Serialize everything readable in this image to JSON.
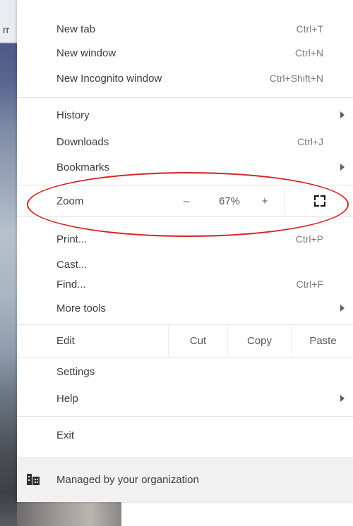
{
  "background": {
    "left_text": "rr"
  },
  "menu": {
    "items_group1": [
      {
        "label": "New tab",
        "shortcut": "Ctrl+T"
      },
      {
        "label": "New window",
        "shortcut": "Ctrl+N"
      },
      {
        "label": "New Incognito window",
        "shortcut": "Ctrl+Shift+N"
      }
    ],
    "items_group2": [
      {
        "label": "History",
        "shortcut": ""
      },
      {
        "label": "Downloads",
        "shortcut": "Ctrl+J"
      },
      {
        "label": "Bookmarks",
        "shortcut": ""
      }
    ],
    "zoom": {
      "label": "Zoom",
      "minus": "–",
      "value": "67%",
      "plus": "+",
      "fullscreen_icon": "fullscreen-icon"
    },
    "items_group3": [
      {
        "label": "Print...",
        "shortcut": "Ctrl+P"
      },
      {
        "label": "Cast...",
        "shortcut": ""
      },
      {
        "label": "Find...",
        "shortcut": "Ctrl+F"
      },
      {
        "label": "More tools",
        "shortcut": ""
      }
    ],
    "edit": {
      "label": "Edit",
      "cut": "Cut",
      "copy": "Copy",
      "paste": "Paste"
    },
    "items_group4": [
      {
        "label": "Settings",
        "shortcut": ""
      },
      {
        "label": "Help",
        "shortcut": ""
      }
    ],
    "exit": {
      "label": "Exit"
    },
    "managed": {
      "label": "Managed by your organization",
      "icon": "building-icon"
    }
  },
  "colors": {
    "annotation": "#d61f1f",
    "menu_bg": "#ffffff",
    "managed_bg": "#f1f1f1"
  }
}
